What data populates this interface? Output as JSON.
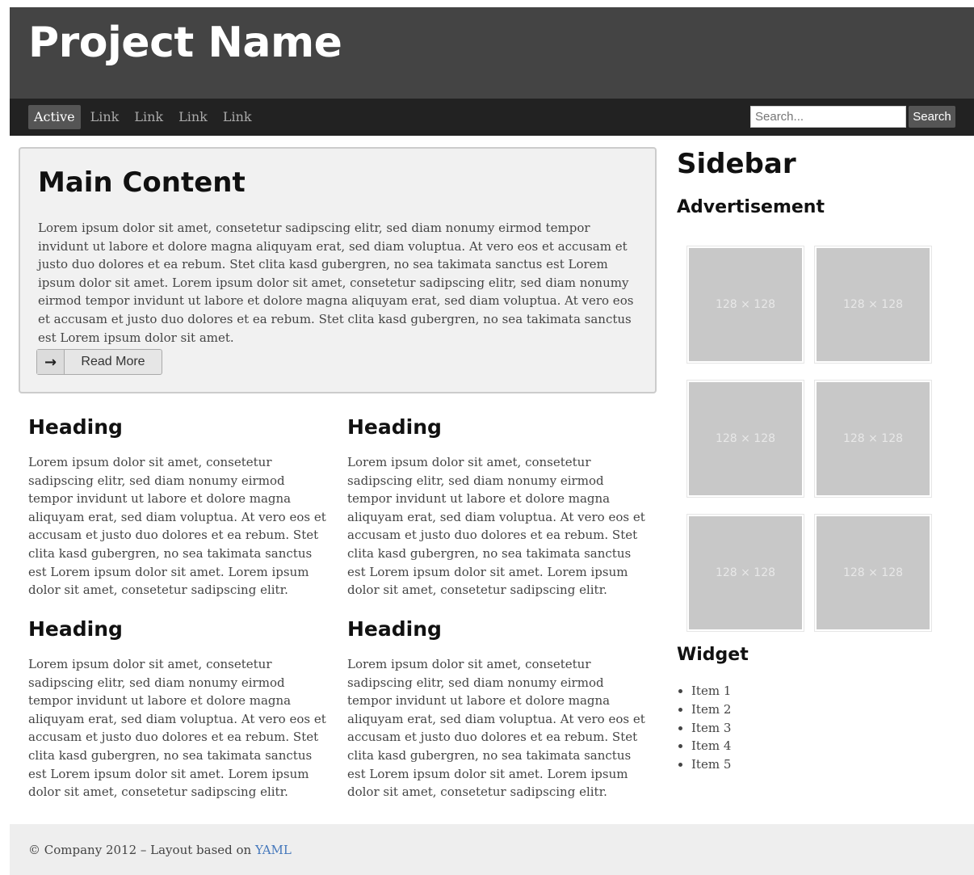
{
  "header": {
    "title": "Project Name"
  },
  "nav": {
    "items": [
      {
        "label": "Active",
        "active": true
      },
      {
        "label": "Link",
        "active": false
      },
      {
        "label": "Link",
        "active": false
      },
      {
        "label": "Link",
        "active": false
      },
      {
        "label": "Link",
        "active": false
      }
    ],
    "search": {
      "placeholder": "Search...",
      "button_label": "Search"
    }
  },
  "main": {
    "title": "Main Content",
    "text": "Lorem ipsum dolor sit amet, consetetur sadipscing elitr, sed diam nonumy eirmod tempor invidunt ut labore et dolore magna aliquyam erat, sed diam voluptua. At vero eos et accusam et justo duo dolores et ea rebum. Stet clita kasd gubergren, no sea takimata sanctus est Lorem ipsum dolor sit amet. Lorem ipsum dolor sit amet, consetetur sadipscing elitr, sed diam nonumy eirmod tempor invidunt ut labore et dolore magna aliquyam erat, sed diam voluptua. At vero eos et accusam et justo duo dolores et ea rebum. Stet clita kasd gubergren, no sea takimata sanctus est Lorem ipsum dolor sit amet.",
    "read_more": {
      "icon": "arrow-right-icon",
      "label": "Read More"
    }
  },
  "teasers": [
    {
      "heading": "Heading",
      "text": "Lorem ipsum dolor sit amet, consetetur sadipscing elitr, sed diam nonumy eirmod tempor invidunt ut labore et dolore magna aliquyam erat, sed diam voluptua. At vero eos et accusam et justo duo dolores et ea rebum. Stet clita kasd gubergren, no sea takimata sanctus est Lorem ipsum dolor sit amet. Lorem ipsum dolor sit amet, consetetur sadipscing elitr."
    },
    {
      "heading": "Heading",
      "text": "Lorem ipsum dolor sit amet, consetetur sadipscing elitr, sed diam nonumy eirmod tempor invidunt ut labore et dolore magna aliquyam erat, sed diam voluptua. At vero eos et accusam et justo duo dolores et ea rebum. Stet clita kasd gubergren, no sea takimata sanctus est Lorem ipsum dolor sit amet. Lorem ipsum dolor sit amet, consetetur sadipscing elitr."
    },
    {
      "heading": "Heading",
      "text": "Lorem ipsum dolor sit amet, consetetur sadipscing elitr, sed diam nonumy eirmod tempor invidunt ut labore et dolore magna aliquyam erat, sed diam voluptua. At vero eos et accusam et justo duo dolores et ea rebum. Stet clita kasd gubergren, no sea takimata sanctus est Lorem ipsum dolor sit amet. Lorem ipsum dolor sit amet, consetetur sadipscing elitr."
    },
    {
      "heading": "Heading",
      "text": "Lorem ipsum dolor sit amet, consetetur sadipscing elitr, sed diam nonumy eirmod tempor invidunt ut labore et dolore magna aliquyam erat, sed diam voluptua. At vero eos et accusam et justo duo dolores et ea rebum. Stet clita kasd gubergren, no sea takimata sanctus est Lorem ipsum dolor sit amet. Lorem ipsum dolor sit amet, consetetur sadipscing elitr."
    }
  ],
  "sidebar": {
    "title": "Sidebar",
    "ad_title": "Advertisement",
    "ads": [
      "128 × 128",
      "128 × 128",
      "128 × 128",
      "128 × 128",
      "128 × 128",
      "128 × 128"
    ],
    "widget_title": "Widget",
    "widget_items": [
      "Item 1",
      "Item 2",
      "Item 3",
      "Item 4",
      "Item 5"
    ]
  },
  "footer": {
    "text": "© Company 2012 – Layout based on ",
    "link": "YAML",
    "link_color": "#4477bb"
  }
}
